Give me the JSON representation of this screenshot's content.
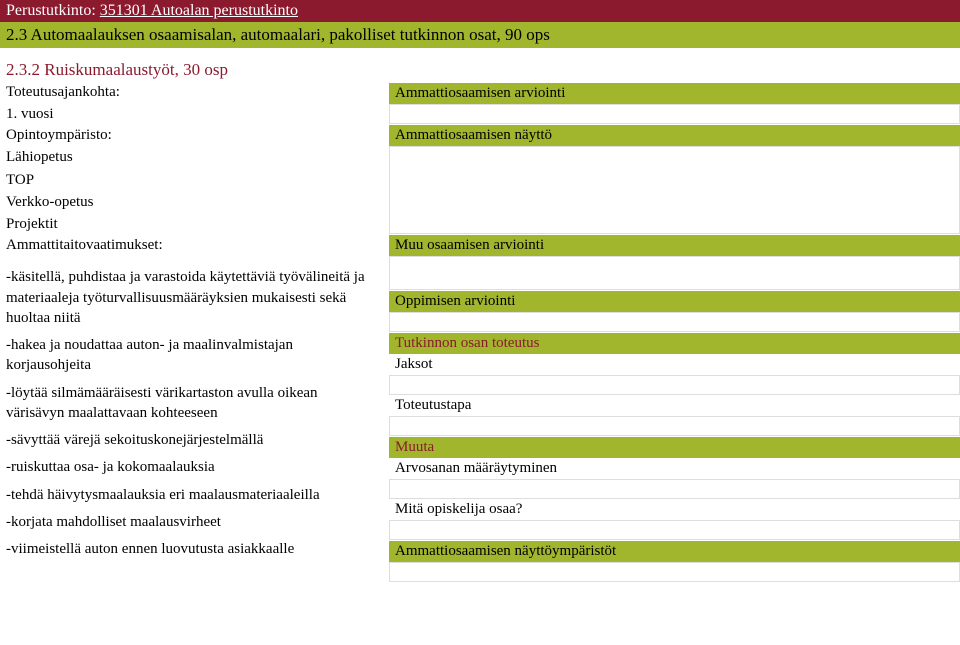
{
  "title": {
    "prefix": "Perustutkinto:",
    "code_and_name": "351301 Autoalan perustutkinto"
  },
  "subtitle": "2.3 Automaalauksen osaamisalan, automaalari, pakolliset tutkinnon osat, 90 ops",
  "section_heading": "2.3.2 Ruiskumaalaustyöt, 30 osp",
  "left": {
    "schedule_label": "Toteutusajankohta:",
    "schedule_value": "1. vuosi",
    "env_label": "Opintoympäristo:",
    "env_items": [
      "Lähiopetus",
      "TOP",
      "Verkko-opetus",
      "Projektit"
    ],
    "requirements_label": "Ammattitaitovaatimukset:",
    "body_items": [
      "-käsitellä, puhdistaa ja varastoida käytettäviä työvälineitä ja materiaaleja työturvallisuusmääräyksien mukaisesti sekä huoltaa niitä",
      "-hakea ja noudattaa auton- ja maalinvalmistajan korjausohjeita",
      "-löytää silmämääräisesti värikartaston avulla oikean värisävyn maalattavaan kohteeseen",
      "-sävyttää värejä sekoituskonejärjestelmällä",
      "-ruiskuttaa osa- ja kokomaalauksia",
      "-tehdä häivytysmaalauksia eri maalausmateriaaleilla",
      "-korjata mahdolliset maalausvirheet",
      "-viimeistellä auton ennen luovutusta asiakkaalle"
    ]
  },
  "right": {
    "assessment1": "Ammattiosaamisen arviointi",
    "assessment2": "Ammattiosaamisen näyttö",
    "other_assessment": "Muu osaamisen arviointi",
    "learning_assessment": "Oppimisen arviointi",
    "unit_impl": "Tutkinnon osan toteutus",
    "periods": "Jaksot",
    "method": "Toteutustapa",
    "other": "Muuta",
    "grading": "Arvosanan määräytyminen",
    "what_learns": "Mitä opiskelija osaa?",
    "demo_envs": "Ammattiosaamisen näyttöympäristöt"
  }
}
